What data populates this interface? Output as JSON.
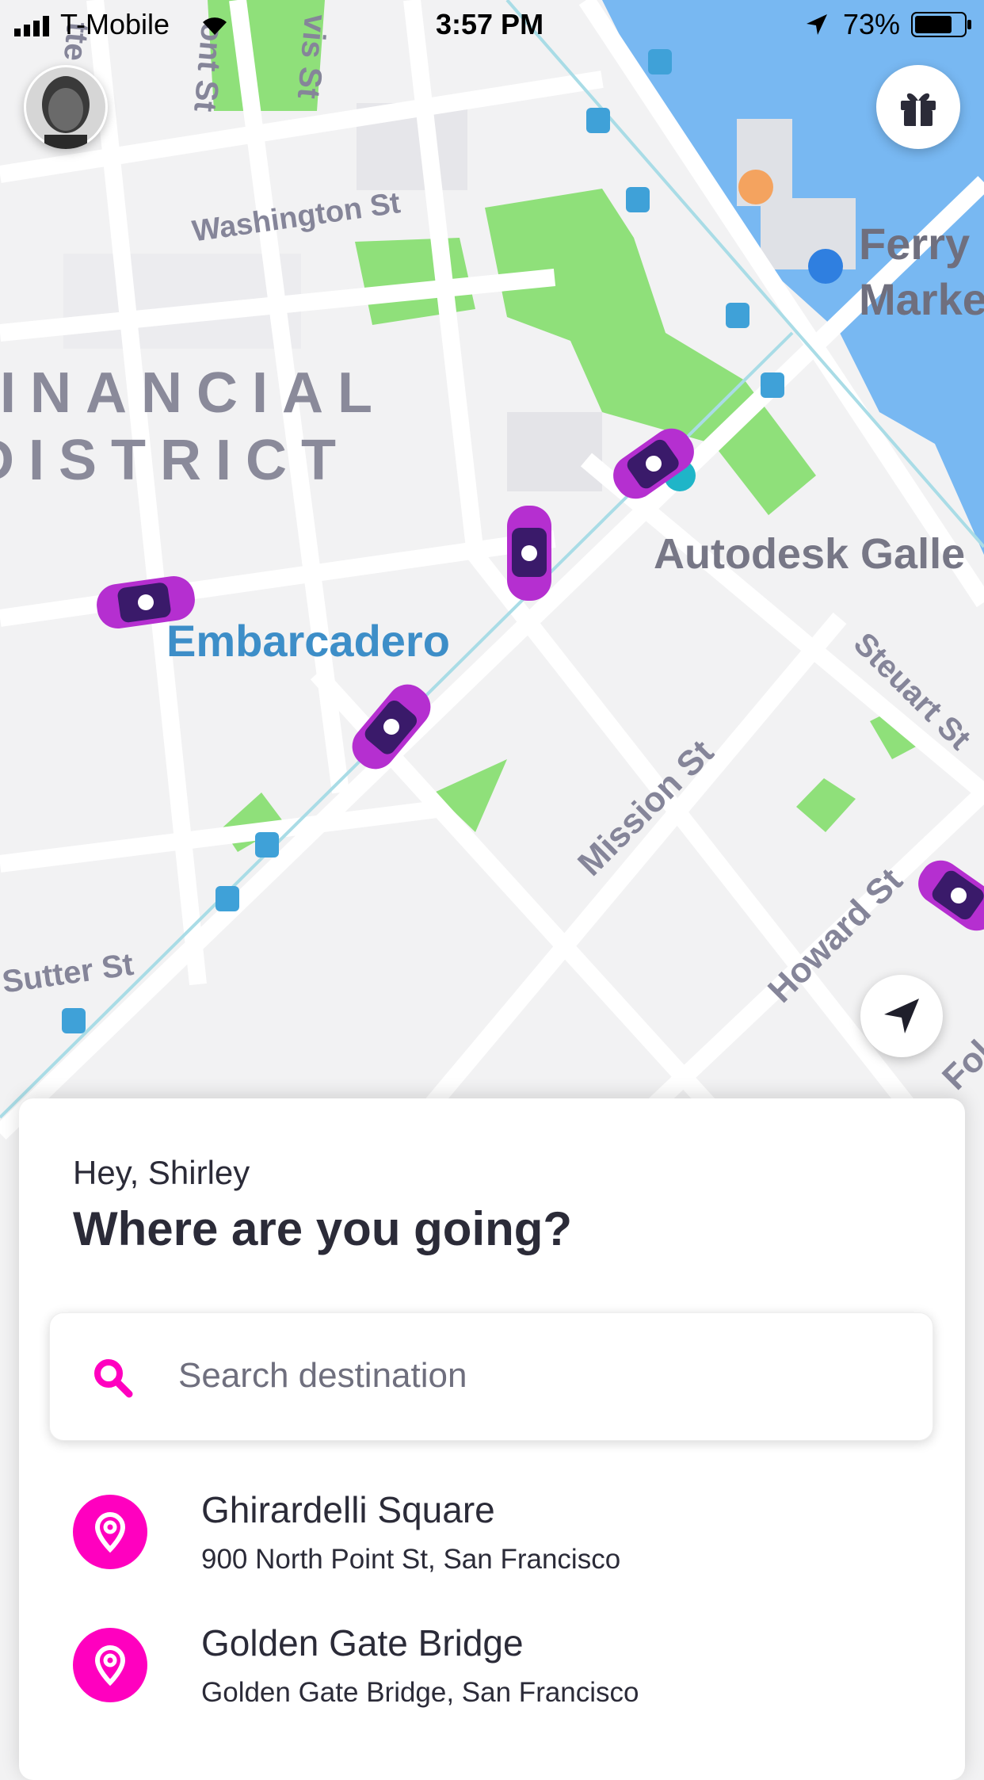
{
  "status_bar": {
    "carrier": "T-Mobile",
    "time": "3:57 PM",
    "battery": "73%"
  },
  "map": {
    "district_line1": "INANCIAL",
    "district_line2": "DISTRICT",
    "streets": {
      "washington": "Washington St",
      "mission": "Mission St",
      "howard": "Howard St",
      "steuart": "Steuart St",
      "sutter": "Sutter St",
      "front": "ont St",
      "davis": "vis St",
      "battery": "tte",
      "folsom": "Fol"
    },
    "places": {
      "embarcadero": "Embarcadero",
      "autodesk": "Autodesk Galle",
      "ferry_line1": "Ferry",
      "ferry_line2": "Marke"
    },
    "colors": {
      "park": "#8fe07a",
      "water": "#78b8f2",
      "accent": "#ff00bf",
      "car_body": "#b52fd0"
    }
  },
  "sheet": {
    "greeting": "Hey, Shirley",
    "title": "Where are you going?",
    "search_placeholder": "Search destination",
    "recent": [
      {
        "name": "Ghirardelli Square",
        "address": "900 North Point St, San Francisco"
      },
      {
        "name": "Golden Gate Bridge",
        "address": "Golden Gate Bridge, San Francisco"
      }
    ]
  },
  "icons": {
    "avatar": "avatar",
    "gift": "gift-icon",
    "locate": "location-arrow-icon",
    "search": "search-icon",
    "pin": "location-pin-icon"
  }
}
